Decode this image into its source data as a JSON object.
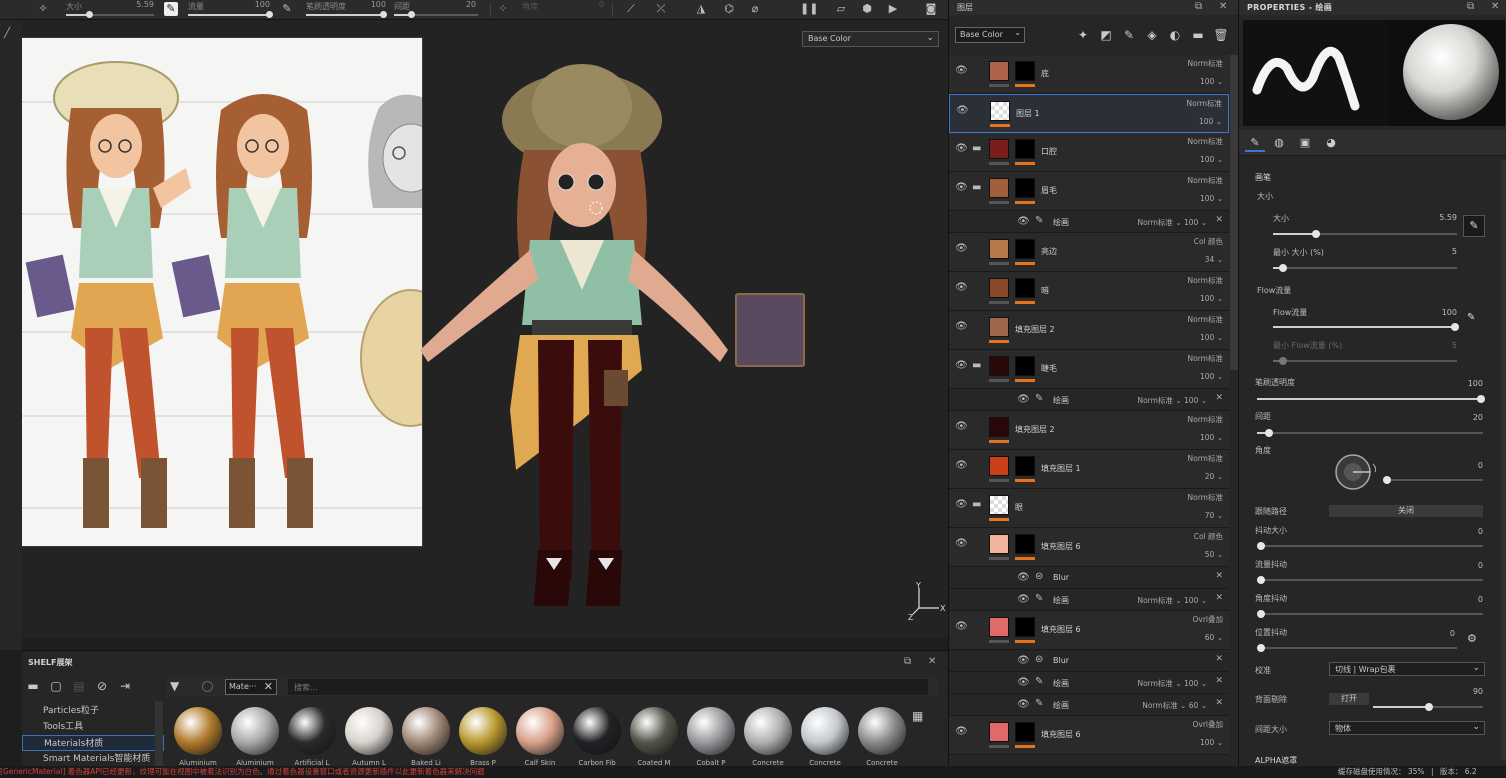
{
  "toolbar": {
    "size_label": "大小",
    "size_value": "5.59",
    "flow_label": "流量",
    "flow_value": "100",
    "stroke_opacity_label": "笔刷透明度",
    "stroke_opacity_value": "100",
    "spacing_label": "间距",
    "spacing_value": "20",
    "angle_label": "角度",
    "angle_value": "0"
  },
  "viewport": {
    "channel_select": "Base Color",
    "axis_y": "Y",
    "axis_x": "X",
    "axis_z": "Z"
  },
  "shelf": {
    "title": "SHELF展架",
    "categories": [
      {
        "label": "Particles粒子"
      },
      {
        "label": "Tools工具"
      },
      {
        "label": "Materials材质"
      },
      {
        "label": "Smart Materials智能材质"
      }
    ],
    "filter_chip": "Mate···",
    "search_placeholder": "搜索...",
    "materials": [
      {
        "label": "Aluminium",
        "color": "#b07a2a"
      },
      {
        "label": "Aluminium",
        "color": "#a9a9a9"
      },
      {
        "label": "Artificial L",
        "color": "#2a2a2a"
      },
      {
        "label": "Autumn L",
        "color": "#d8d2cc"
      },
      {
        "label": "Baked Li",
        "color": "#a08878"
      },
      {
        "label": "Brass P",
        "color": "#b8982e"
      },
      {
        "label": "Calf Skin",
        "color": "#d8a08a"
      },
      {
        "label": "Carbon Fib",
        "color": "#222226"
      },
      {
        "label": "Coated M",
        "color": "#55544a"
      },
      {
        "label": "Cobalt P",
        "color": "#9a9a9e"
      },
      {
        "label": "Concrete",
        "color": "#b0b0ae"
      },
      {
        "label": "Concrete",
        "color": "#c4c8cc"
      },
      {
        "label": "Concrete",
        "color": "#8a8a8a"
      }
    ]
  },
  "status": {
    "error": "[GenericMaterial] 着色器API已经更新，纹理可能在视图中被着法识别为白色。通过着色器设置窗口或者资源更新插件以此更新着色器来解决问题",
    "cache": "缓存磁盘使用情况：",
    "cache_value": "35%",
    "version_label": "版本：",
    "version_value": "6.2"
  },
  "layers": {
    "title": "图层",
    "channel": "Base Color",
    "items": [
      {
        "kind": "layer",
        "name": "底",
        "blend": "Norm标准",
        "opacity": "100",
        "thumb": "#b0624a",
        "mask": true,
        "folder": false
      },
      {
        "kind": "layer",
        "name": "图层 1",
        "blend": "Norm标准",
        "opacity": "100",
        "thumb": "checker",
        "mask": false,
        "folder": false,
        "selected": true
      },
      {
        "kind": "layer",
        "name": "口腔",
        "blend": "Norm标准",
        "opacity": "100",
        "thumb": "#7a1d1d",
        "mask": true,
        "folder": true
      },
      {
        "kind": "layer",
        "name": "眉毛",
        "blend": "Norm标准",
        "opacity": "100",
        "thumb": "#a2603a",
        "mask": true,
        "folder": true
      },
      {
        "kind": "effect",
        "name": "绘画",
        "blend": "Norm标准",
        "opacity": "100"
      },
      {
        "kind": "layer",
        "name": "亮边",
        "blend": "Col 颜色",
        "opacity": "34",
        "thumb": "#b57a48",
        "mask": true,
        "folder": false
      },
      {
        "kind": "layer",
        "name": "暗",
        "blend": "Norm标准",
        "opacity": "100",
        "thumb": "#8a4a2a",
        "mask": true,
        "folder": false
      },
      {
        "kind": "layer",
        "name": "填充图层 2",
        "blend": "Norm标准",
        "opacity": "100",
        "thumb": "#a0684a",
        "mask": false,
        "folder": false
      },
      {
        "kind": "layer",
        "name": "睫毛",
        "blend": "Norm标准",
        "opacity": "100",
        "thumb": "#2a0a08",
        "mask": true,
        "folder": true
      },
      {
        "kind": "effect",
        "name": "绘画",
        "blend": "Norm标准",
        "opacity": "100"
      },
      {
        "kind": "layer",
        "name": "填充图层 2",
        "blend": "Norm标准",
        "opacity": "100",
        "thumb": "#2a0808",
        "mask": false,
        "folder": false
      },
      {
        "kind": "layer",
        "name": "填充图层 1",
        "blend": "Norm标准",
        "opacity": "20",
        "thumb": "#c8401a",
        "mask": true,
        "folder": false
      },
      {
        "kind": "layer",
        "name": "眼",
        "blend": "Norm标准",
        "opacity": "70",
        "thumb": "checker",
        "mask": false,
        "folder": true
      },
      {
        "kind": "layer",
        "name": "填充图层 6",
        "blend": "Col 颜色",
        "opacity": "50",
        "thumb": "#f2b49c",
        "mask": true,
        "folder": false
      },
      {
        "kind": "blur",
        "name": "Blur"
      },
      {
        "kind": "effect",
        "name": "绘画",
        "blend": "Norm标准",
        "opacity": "100"
      },
      {
        "kind": "layer",
        "name": "填充图层 6",
        "blend": "Ovrl叠加",
        "opacity": "60",
        "thumb": "#e06a6a",
        "mask": true,
        "folder": false
      },
      {
        "kind": "blur",
        "name": "Blur"
      },
      {
        "kind": "effect",
        "name": "绘画",
        "blend": "Norm标准",
        "opacity": "100"
      },
      {
        "kind": "effect",
        "name": "绘画",
        "blend": "Norm标准",
        "opacity": "60"
      },
      {
        "kind": "layer",
        "name": "填充图层 6",
        "blend": "Ovrl叠加",
        "opacity": "100",
        "thumb": "#e06a6a",
        "mask": true,
        "folder": false
      }
    ]
  },
  "props": {
    "title": "PROPERTIES - 绘画",
    "section_brush": "画笔",
    "size_group": "大小",
    "size_label": "大小",
    "size_value": "5.59",
    "min_size_label": "最小 大小 (%)",
    "min_size_value": "5",
    "flow_group": "Flow流量",
    "flow_label": "Flow流量",
    "flow_value": "100",
    "min_flow_label": "最小 Flow流量 (%)",
    "min_flow_value": "5",
    "opacity_label": "笔刷透明度",
    "opacity_value": "100",
    "spacing_label": "间距",
    "spacing_value": "20",
    "angle_label": "角度",
    "angle_value": "0",
    "follow_path_label": "跟随路径",
    "follow_path_value": "关闭",
    "jitter_size_label": "抖动大小",
    "jitter_size_value": "0",
    "jitter_flow_label": "流量抖动",
    "jitter_flow_value": "0",
    "jitter_angle_label": "角度抖动",
    "jitter_angle_value": "0",
    "jitter_pos_label": "位置抖动",
    "jitter_pos_value": "0",
    "align_label": "校准",
    "align_value": "切线 | Wrap包裹",
    "backface_label": "背面剔除",
    "backface_btn": "打开",
    "backface_value": "90",
    "spacing_size_label": "间距大小",
    "spacing_size_value": "物体",
    "alpha_label": "ALPHA遮罩"
  }
}
